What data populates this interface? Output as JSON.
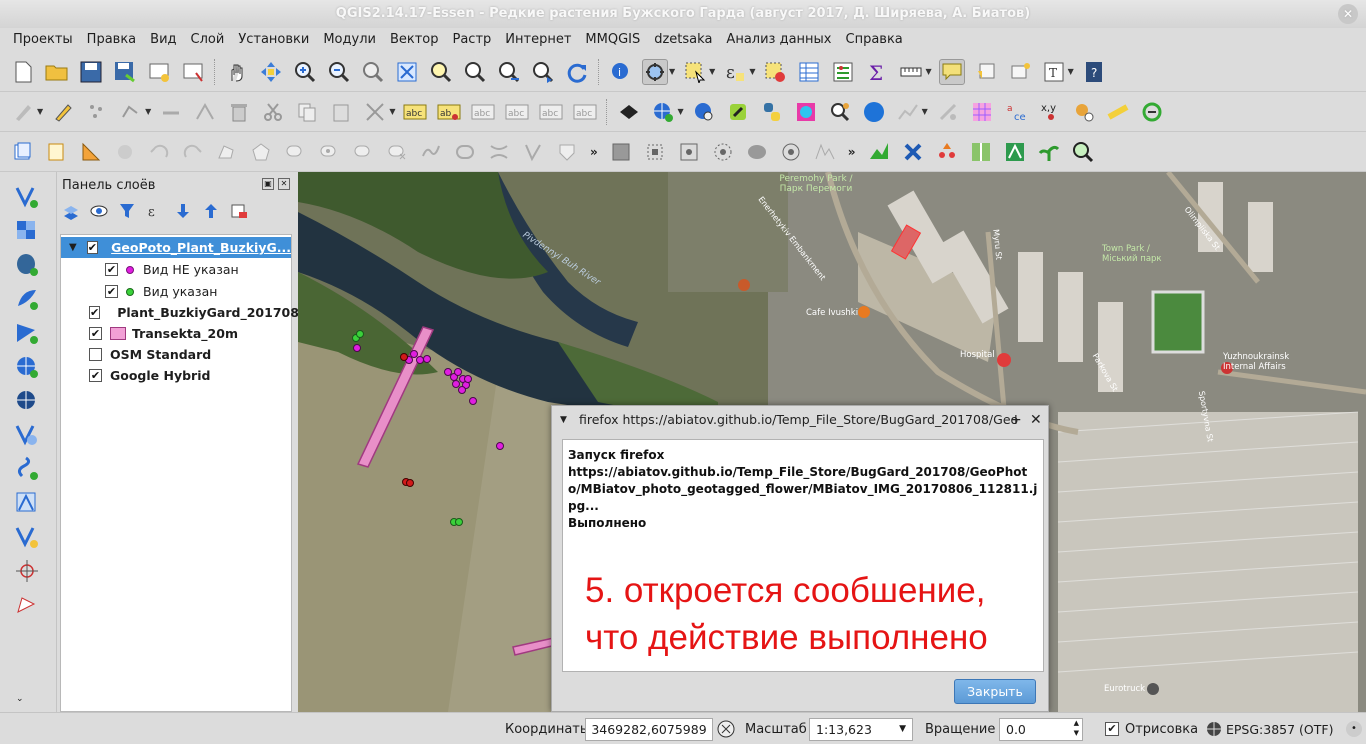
{
  "app": {
    "title": "QGIS2.14.17-Essen - Редкие растения Бужского Гарда (август 2017, Д. Ширяева, А. Биатов)",
    "close_glyph": "✕"
  },
  "menu": [
    "Проекты",
    "Правка",
    "Вид",
    "Слой",
    "Установки",
    "Модули",
    "Вектор",
    "Растр",
    "Интернет",
    "MMQGIS",
    "dzetsaka",
    "Анализ данных",
    "Справка"
  ],
  "layers_panel": {
    "title": "Панель слоёв",
    "layers": [
      {
        "name": "GeoPoto_Plant_BuzkiyG...",
        "checked": true,
        "expanded": true,
        "selected": true,
        "symbol": "none"
      },
      {
        "name": "Вид НЕ указан",
        "checked": true,
        "child": true,
        "symbol": "magenta-dot",
        "color": "#e01ee0"
      },
      {
        "name": "Вид указан",
        "checked": true,
        "child": true,
        "symbol": "green-dot",
        "color": "#3ad13a"
      },
      {
        "name": "Plant_BuzkiyGard_201708",
        "checked": true,
        "symbol": "red-dot",
        "color": "#d11a1a"
      },
      {
        "name": "Transekta_20m",
        "checked": true,
        "symbol": "pink-rect",
        "color": "#f2a0d6"
      },
      {
        "name": "OSM Standard",
        "checked": false,
        "symbol": "none"
      },
      {
        "name": "Google Hybrid",
        "checked": true,
        "symbol": "none"
      }
    ]
  },
  "map_labels": {
    "river": "Pivdennyi Buh River",
    "park": "Peremohy Park / Парк Перемоги",
    "street1": "Enerhetykiv Embankment",
    "street2": "Myru St",
    "street3": "Olimpiiska St",
    "cafe": "Cafe Ivushki",
    "hospital": "Hospital",
    "town_park": "Town Park / Міський парк",
    "internat": "Yuzhnoukrainsk Internal Affairs",
    "eurotruck": "Eurotruck",
    "parkova": "Parkova St",
    "sportyvna": "Sportyvna St"
  },
  "dialog": {
    "title": "firefox https://abiatov.github.io/Temp_File_Store/BugGard_201708/Geo",
    "line1": "Запуск firefox",
    "line2": "https://abiatov.github.io/Temp_File_Store/BugGard_201708/GeoPhoto/MBiatov_photo_geotagged_flower/MBiatov_IMG_20170806_112811.jpg...",
    "line3": "Выполнено",
    "close_button": "Закрыть",
    "annotation_line1": "5. откроется сообшение,",
    "annotation_line2": "что действие выполнено"
  },
  "statusbar": {
    "coords_label": "Координаты",
    "coords_value": "3469282,6075989",
    "scale_label": "Масштаб",
    "scale_value": "1:13,623",
    "rotation_label": "Вращение",
    "rotation_value": "0.0",
    "render_label": "Отрисовка",
    "render_checked": true,
    "crs": "EPSG:3857 (OTF)"
  }
}
